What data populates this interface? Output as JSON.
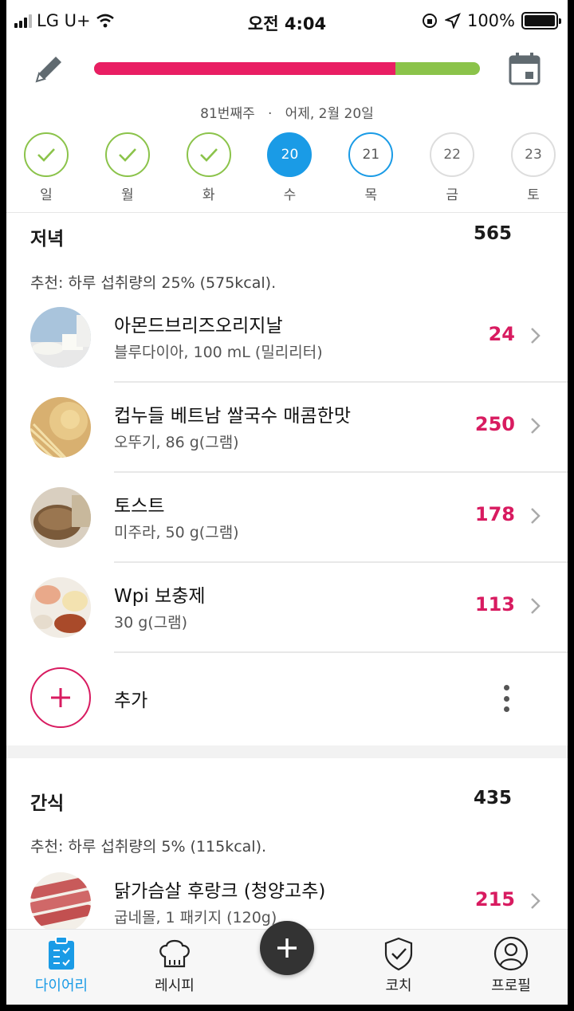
{
  "status_bar": {
    "carrier": "LG U+",
    "time": "오전 4:04",
    "battery": "100%"
  },
  "header": {
    "progress_fraction": 0.78,
    "week_label": "81번째주",
    "separator": "·",
    "date_label": "어제, 2월 20일",
    "days": [
      {
        "label": "일",
        "number": "",
        "state": "done"
      },
      {
        "label": "월",
        "number": "",
        "state": "done"
      },
      {
        "label": "화",
        "number": "",
        "state": "done"
      },
      {
        "label": "수",
        "number": "20",
        "state": "today"
      },
      {
        "label": "목",
        "number": "21",
        "state": "next"
      },
      {
        "label": "금",
        "number": "22",
        "state": "future"
      },
      {
        "label": "토",
        "number": "23",
        "state": "future"
      }
    ]
  },
  "dinner": {
    "title": "저녁",
    "total": "565",
    "recommendation": "추천: 하루 섭취량의 25% (575kcal).",
    "items": [
      {
        "name": "아몬드브리즈오리지날",
        "detail": "블루다이아, 100 mL (밀리리터)",
        "kcal": "24"
      },
      {
        "name": "컵누들 베트남 쌀국수 매콤한맛",
        "detail": "오뚜기, 86 g(그램)",
        "kcal": "250"
      },
      {
        "name": "토스트",
        "detail": "미주라, 50 g(그램)",
        "kcal": "178"
      },
      {
        "name": "Wpi 보충제",
        "detail": "30 g(그램)",
        "kcal": "113"
      }
    ],
    "add_label": "추가"
  },
  "snack": {
    "title": "간식",
    "total": "435",
    "recommendation": "추천: 하루 섭취량의 5% (115kcal).",
    "items": [
      {
        "name": "닭가슴살 후랑크 (청양고추)",
        "detail": "굽네몰, 1 패키지 (120g)",
        "kcal": "215"
      }
    ]
  },
  "tabs": [
    {
      "label": "다이어리",
      "icon": "clipboard-icon",
      "active": true
    },
    {
      "label": "레시피",
      "icon": "chef-hat-icon",
      "active": false
    },
    {
      "label": "코치",
      "icon": "shield-check-icon",
      "active": false
    },
    {
      "label": "프로필",
      "icon": "person-icon",
      "active": false
    }
  ],
  "colors": {
    "accent": "#1a9be6",
    "kcal": "#d81b60",
    "progress_over": "#e91e63",
    "progress_remaining": "#8bc34a",
    "done": "#8bc34a"
  }
}
